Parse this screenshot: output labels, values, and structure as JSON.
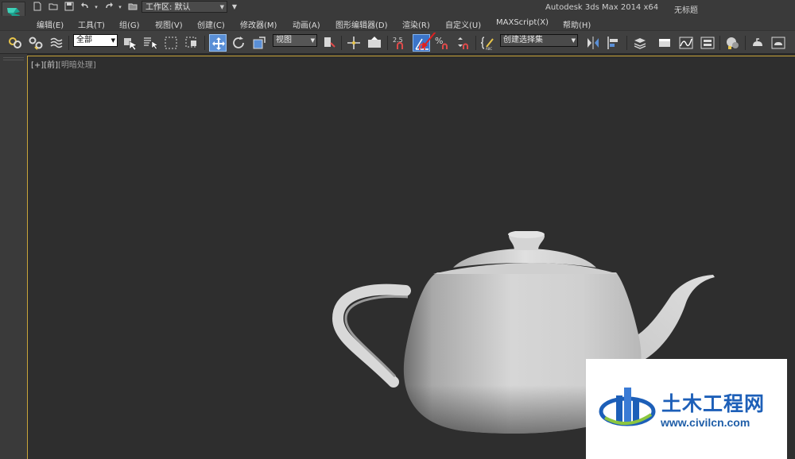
{
  "titlebar": {
    "workspace_label": "工作区: 默认",
    "app_title": "Autodesk 3ds Max  2014 x64",
    "doc_title": "无标题",
    "quick_access_icons": [
      "new-file-icon",
      "open-file-icon",
      "save-icon",
      "undo-icon",
      "redo-icon",
      "project-folder-icon"
    ]
  },
  "menu": {
    "items": [
      "编辑(E)",
      "工具(T)",
      "组(G)",
      "视图(V)",
      "创建(C)",
      "修改器(M)",
      "动画(A)",
      "图形编辑器(D)",
      "渲染(R)",
      "自定义(U)",
      "MAXScript(X)",
      "帮助(H)"
    ]
  },
  "toolbar": {
    "selection_filter": "全部",
    "reference_coord": "视图",
    "named_selection": "创建选择集",
    "snap_value": "2.5",
    "active_tool": "angle-snap-toggle",
    "accent_color": "#5a8fd6"
  },
  "viewport": {
    "label_plus": "[+]",
    "label_view": "[前]",
    "label_shading": "[明暗处理]",
    "border_color": "#c9a53a"
  },
  "watermark": {
    "title": "土木工程网",
    "url": "www.civilcn.com",
    "brand_color": "#1d5fb8"
  }
}
